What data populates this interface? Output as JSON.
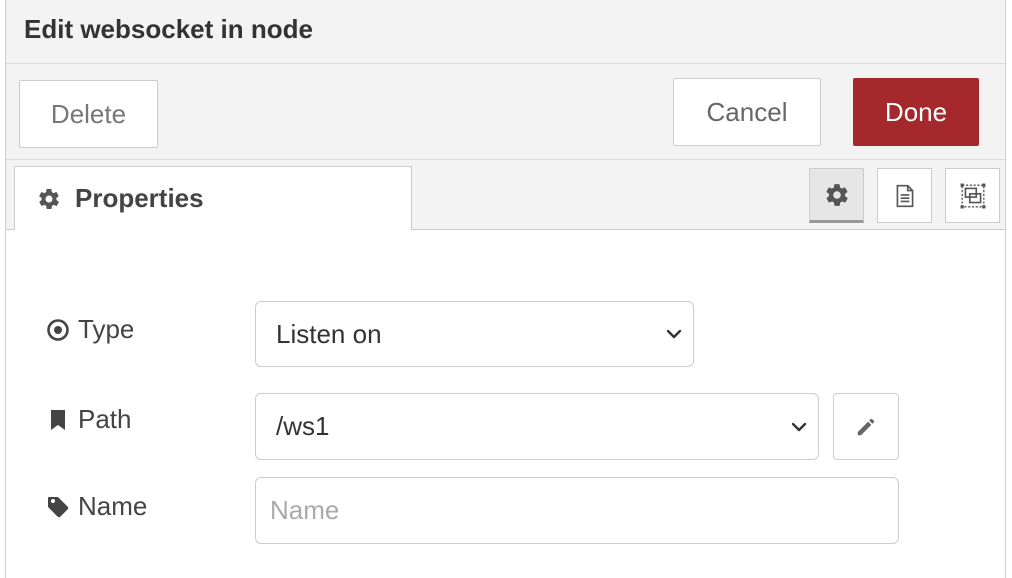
{
  "tray": {
    "title": "Edit websocket in node"
  },
  "toolbar": {
    "delete_label": "Delete",
    "cancel_label": "Cancel",
    "done_label": "Done"
  },
  "tabs": {
    "properties_label": "Properties",
    "icons": [
      "gear-icon",
      "document-icon",
      "appearance-icon"
    ]
  },
  "form": {
    "type": {
      "label": "Type",
      "icon": "dot-circle-icon",
      "value": "Listen on"
    },
    "path": {
      "label": "Path",
      "icon": "bookmark-icon",
      "value": "/ws1",
      "edit_icon": "pencil-icon"
    },
    "name": {
      "label": "Name",
      "icon": "tag-icon",
      "value": "",
      "placeholder": "Name"
    }
  },
  "colors": {
    "done_button": "#a4282c",
    "header_bg": "#f3f3f3",
    "border": "#cccccc"
  }
}
